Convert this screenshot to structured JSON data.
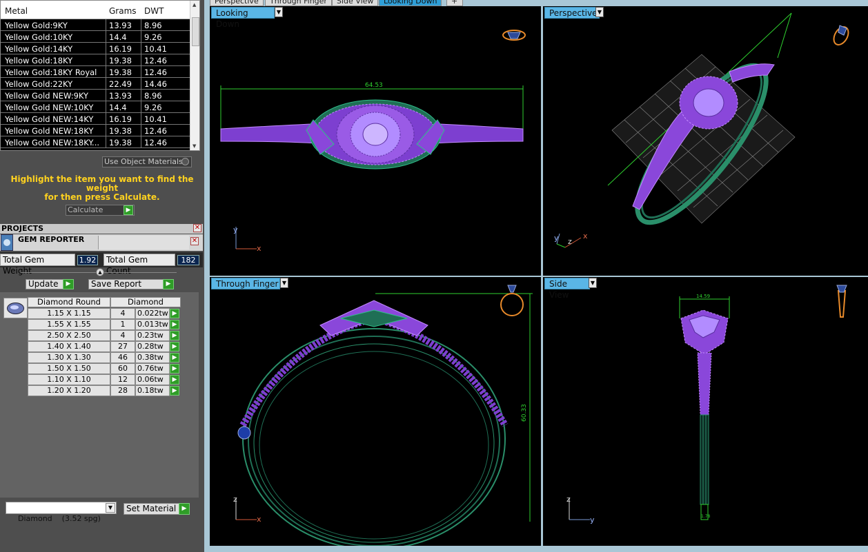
{
  "metal_table": {
    "headers": [
      "Metal",
      "Grams",
      "DWT"
    ],
    "rows": [
      {
        "metal": "Yellow Gold:9KY",
        "grams": "13.93",
        "dwt": "8.96"
      },
      {
        "metal": "Yellow Gold:10KY",
        "grams": "14.4",
        "dwt": "9.26"
      },
      {
        "metal": "Yellow Gold:14KY",
        "grams": "16.19",
        "dwt": "10.41"
      },
      {
        "metal": "Yellow Gold:18KY",
        "grams": "19.38",
        "dwt": "12.46"
      },
      {
        "metal": "Yellow Gold:18KY Royal",
        "grams": "19.38",
        "dwt": "12.46"
      },
      {
        "metal": "Yellow Gold:22KY",
        "grams": "22.49",
        "dwt": "14.46"
      },
      {
        "metal": "Yellow Gold NEW:9KY",
        "grams": "13.93",
        "dwt": "8.96"
      },
      {
        "metal": "Yellow Gold NEW:10KY",
        "grams": "14.4",
        "dwt": "9.26"
      },
      {
        "metal": "Yellow Gold NEW:14KY",
        "grams": "16.19",
        "dwt": "10.41"
      },
      {
        "metal": "Yellow Gold NEW:18KY",
        "grams": "19.38",
        "dwt": "12.46"
      },
      {
        "metal": "Yellow Gold NEW:18KY...",
        "grams": "19.38",
        "dwt": "12.46"
      }
    ]
  },
  "use_object_materials_label": "Use Object Materials",
  "hint_line1": "Highlight the item you want to find the weight",
  "hint_line2": "for then press Calculate.",
  "calculate_label": "Calculate",
  "projects_label": "PROJECTS",
  "gem_reporter": {
    "title": "GEM REPORTER",
    "total_weight_label": "Total Gem Weight",
    "total_weight_value": "1.92",
    "total_count_label": "Total Gem Count",
    "total_count_value": "182",
    "update_label": "Update",
    "save_report_label": "Save Report",
    "table_headers": [
      "Diamond Round",
      "Diamond"
    ],
    "rows": [
      {
        "size": "1.15 X 1.15",
        "count": "4",
        "weight": "0.022tw"
      },
      {
        "size": "1.55 X 1.55",
        "count": "1",
        "weight": "0.013tw"
      },
      {
        "size": "2.50 X 2.50",
        "count": "4",
        "weight": "0.23tw"
      },
      {
        "size": "1.40 X 1.40",
        "count": "27",
        "weight": "0.28tw"
      },
      {
        "size": "1.30 X 1.30",
        "count": "46",
        "weight": "0.38tw"
      },
      {
        "size": "1.50 X 1.50",
        "count": "60",
        "weight": "0.76tw"
      },
      {
        "size": "1.10 X 1.10",
        "count": "12",
        "weight": "0.06tw"
      },
      {
        "size": "1.20 X 1.20",
        "count": "28",
        "weight": "0.18tw"
      }
    ]
  },
  "material_select_value": "Diamond    (3.52 spg)",
  "set_material_label": "Set Material",
  "top_tabs": [
    "Perspective",
    "Through Finger",
    "Side View",
    "Looking Down"
  ],
  "viewports": {
    "top_left": {
      "label": "Looking Down",
      "dimension": "64.53",
      "axis1": "y",
      "axis2": "x"
    },
    "top_right": {
      "label": "Perspective",
      "axis1": "y",
      "axis2": "z",
      "axis3": "x"
    },
    "bottom_left": {
      "label": "Through Finger",
      "dimension": "60.33",
      "axis1": "z",
      "axis2": "x"
    },
    "bottom_right": {
      "label": "Side View",
      "dimension_top": "14.59",
      "dimension_bottom": "1.78",
      "axis1": "z",
      "axis2": "y"
    }
  },
  "colors": {
    "gem_purple": "#9b4fd9",
    "metal_green": "#2a8f6a",
    "dim_green": "#2fd12f",
    "accent_blue": "#5ab6e6",
    "hint_yellow": "#ffd21f"
  }
}
